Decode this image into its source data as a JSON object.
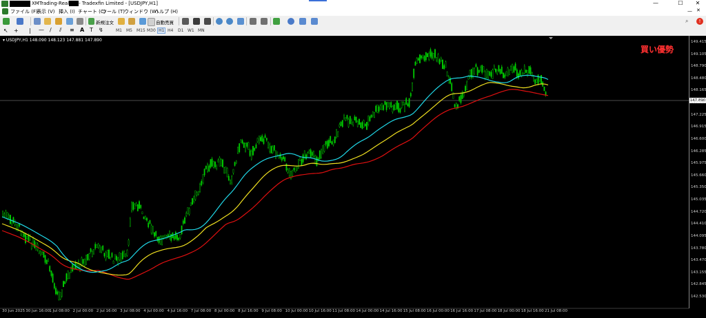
{
  "window": {
    "title_prefix": "XMTrading-Real",
    "title_suffix": "- Tradexfin Limited - [USDJPY,H1]",
    "controls": {
      "minimize": "—",
      "maximize": "☐",
      "close": "✕"
    }
  },
  "menu": [
    "ファイル (F)",
    "表示 (V)",
    "挿入 (I)",
    "チャート (C)",
    "ツール (T)",
    "ウィンドウ (W)",
    "ヘルプ (H)"
  ],
  "toolbar": {
    "new_order": "新規注文",
    "auto_trade": "自動売買",
    "timeframes": [
      "M1",
      "M5",
      "M15",
      "M30",
      "H1",
      "H4",
      "D1",
      "W1",
      "MN"
    ],
    "selected_timeframe": "H1"
  },
  "chart": {
    "symbol_info": "USDJPY,H1  148.090 148.123 147.881 147.890",
    "overlay_text": "買い優勢",
    "current_price": "147.890",
    "price_ticks": [
      "149.415",
      "149.105",
      "148.790",
      "148.480",
      "148.165",
      "147.540",
      "147.225",
      "146.915",
      "146.600",
      "146.285",
      "145.975",
      "145.660",
      "145.350",
      "145.035",
      "144.720",
      "144.410",
      "144.095",
      "143.780",
      "143.470",
      "143.155",
      "142.845",
      "142.530"
    ],
    "time_ticks": [
      "30 Jun 2025",
      "30 Jun 16:00",
      "1 Jul 08:00",
      "2 Jul 00:00",
      "2 Jul 16:00",
      "3 Jul 08:00",
      "4 Jul 00:00",
      "4 Jul 16:00",
      "7 Jul 08:00",
      "8 Jul 00:00",
      "8 Jul 16:00",
      "9 Jul 08:00",
      "10 Jul 00:00",
      "10 Jul 16:00",
      "11 Jul 08:00",
      "14 Jul 00:00",
      "14 Jul 16:00",
      "15 Jul 08:00",
      "16 Jul 00:00",
      "16 Jul 16:00",
      "17 Jul 08:00",
      "18 Jul 00:00",
      "18 Jul 16:00",
      "21 Jul 08:00"
    ],
    "colors": {
      "candles": "#00d000",
      "ma_fast": "#20d8e8",
      "ma_mid": "#f0e020",
      "ma_slow": "#e01010",
      "bg": "#000000"
    }
  }
}
